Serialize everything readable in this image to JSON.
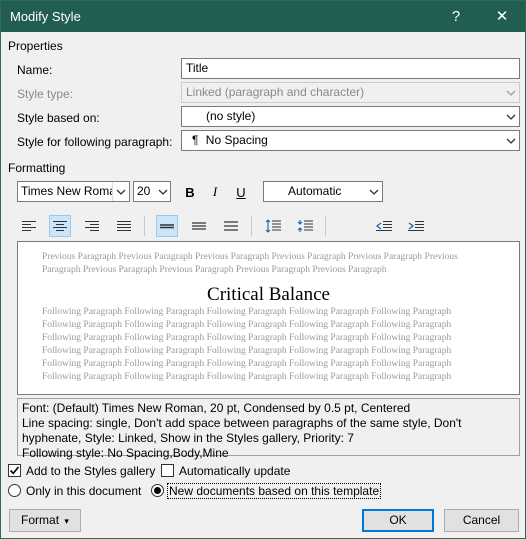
{
  "window": {
    "title": "Modify Style",
    "help_glyph": "?",
    "close_glyph": "✕"
  },
  "properties": {
    "heading": "Properties",
    "name_label": "Name:",
    "name_value": "Title",
    "style_type_label": "Style type:",
    "style_type_value": "Linked (paragraph and character)",
    "based_on_label": "Style based on:",
    "based_on_value": "(no style)",
    "following_label": "Style for following paragraph:",
    "following_value": "No Spacing",
    "following_glyph": "¶"
  },
  "formatting": {
    "heading": "Formatting",
    "font_name": "Times New Roman",
    "font_size": "20",
    "bold": "B",
    "italic": "I",
    "underline": "U",
    "color": "Automatic"
  },
  "preview": {
    "previous_lines": [
      "Previous Paragraph Previous Paragraph Previous Paragraph Previous Paragraph Previous Paragraph Previous",
      "Paragraph Previous Paragraph Previous Paragraph Previous Paragraph Previous Paragraph"
    ],
    "sample_text": "Critical Balance",
    "following_lines": [
      "Following Paragraph Following Paragraph Following Paragraph Following Paragraph Following Paragraph",
      "Following Paragraph Following Paragraph Following Paragraph Following Paragraph Following Paragraph",
      "Following Paragraph Following Paragraph Following Paragraph Following Paragraph Following Paragraph",
      "Following Paragraph Following Paragraph Following Paragraph Following Paragraph Following Paragraph",
      "Following Paragraph Following Paragraph Following Paragraph Following Paragraph Following Paragraph",
      "Following Paragraph Following Paragraph Following Paragraph Following Paragraph Following Paragraph"
    ]
  },
  "description": [
    "Font: (Default) Times New Roman, 20 pt, Condensed by  0.5 pt, Centered",
    "    Line spacing:  single, Don't add space between paragraphs of the same style, Don't",
    "    hyphenate, Style: Linked, Show in the Styles gallery, Priority: 7",
    "    Following style: No Spacing,Body,Mine"
  ],
  "options": {
    "add_to_gallery": "Add to the Styles gallery",
    "auto_update": "Automatically update",
    "only_this_doc": "Only in this document",
    "new_docs": "New documents based on this template"
  },
  "buttons": {
    "format": "Format",
    "format_arrow": "▾",
    "ok": "OK",
    "cancel": "Cancel"
  },
  "colors": {
    "titlebar": "#215d51",
    "selected_tool": "#cce4f7",
    "default_button_border": "#0078d7"
  }
}
